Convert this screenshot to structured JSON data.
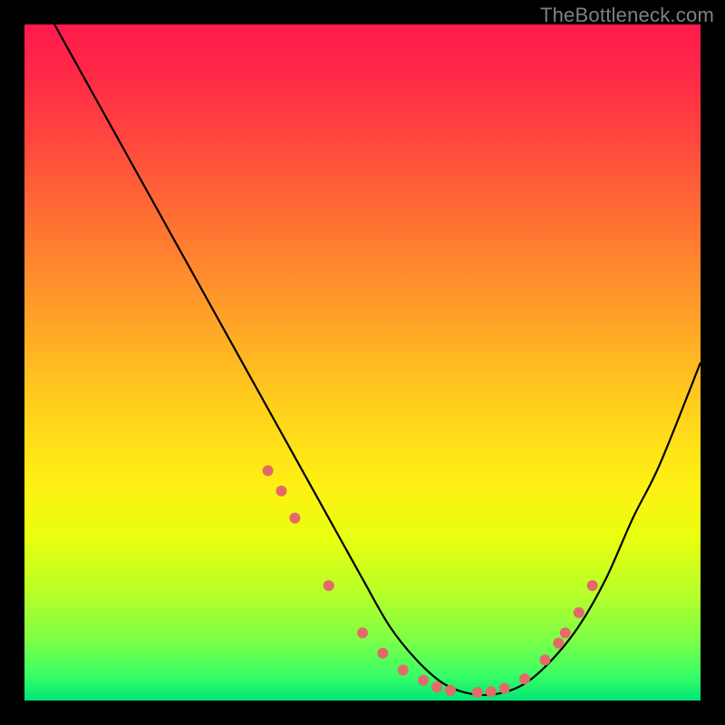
{
  "watermark": "TheBottleneck.com",
  "colors": {
    "background": "#000000",
    "gradient_top": "#ff1a4d",
    "gradient_bottom": "#00e676",
    "curve": "#000000",
    "markers": "#e46a6a",
    "watermark": "#808080"
  },
  "chart_data": {
    "type": "line",
    "title": "",
    "xlabel": "",
    "ylabel": "",
    "xlim": [
      0,
      100
    ],
    "ylim": [
      0,
      100
    ],
    "grid": false,
    "legend": false,
    "series": [
      {
        "name": "bottleneck-curve",
        "x": [
          0,
          5,
          10,
          15,
          20,
          25,
          30,
          35,
          40,
          45,
          50,
          54,
          58,
          62,
          66,
          70,
          74,
          78,
          82,
          86,
          90,
          94,
          100
        ],
        "values": [
          108,
          99,
          90,
          81,
          72,
          63,
          54,
          45,
          36,
          27,
          18,
          11,
          6,
          2.5,
          1,
          1,
          2.5,
          6,
          11,
          18,
          27,
          35,
          50
        ]
      }
    ],
    "markers": {
      "name": "highlight-points",
      "x": [
        36,
        38,
        40,
        45,
        50,
        53,
        56,
        59,
        61,
        63,
        67,
        69,
        71,
        74,
        77,
        79,
        80,
        82,
        84
      ],
      "values": [
        34,
        31,
        27,
        17,
        10,
        7,
        4.5,
        3,
        2,
        1.5,
        1.2,
        1.3,
        1.8,
        3.2,
        6,
        8.5,
        10,
        13,
        17
      ]
    }
  }
}
